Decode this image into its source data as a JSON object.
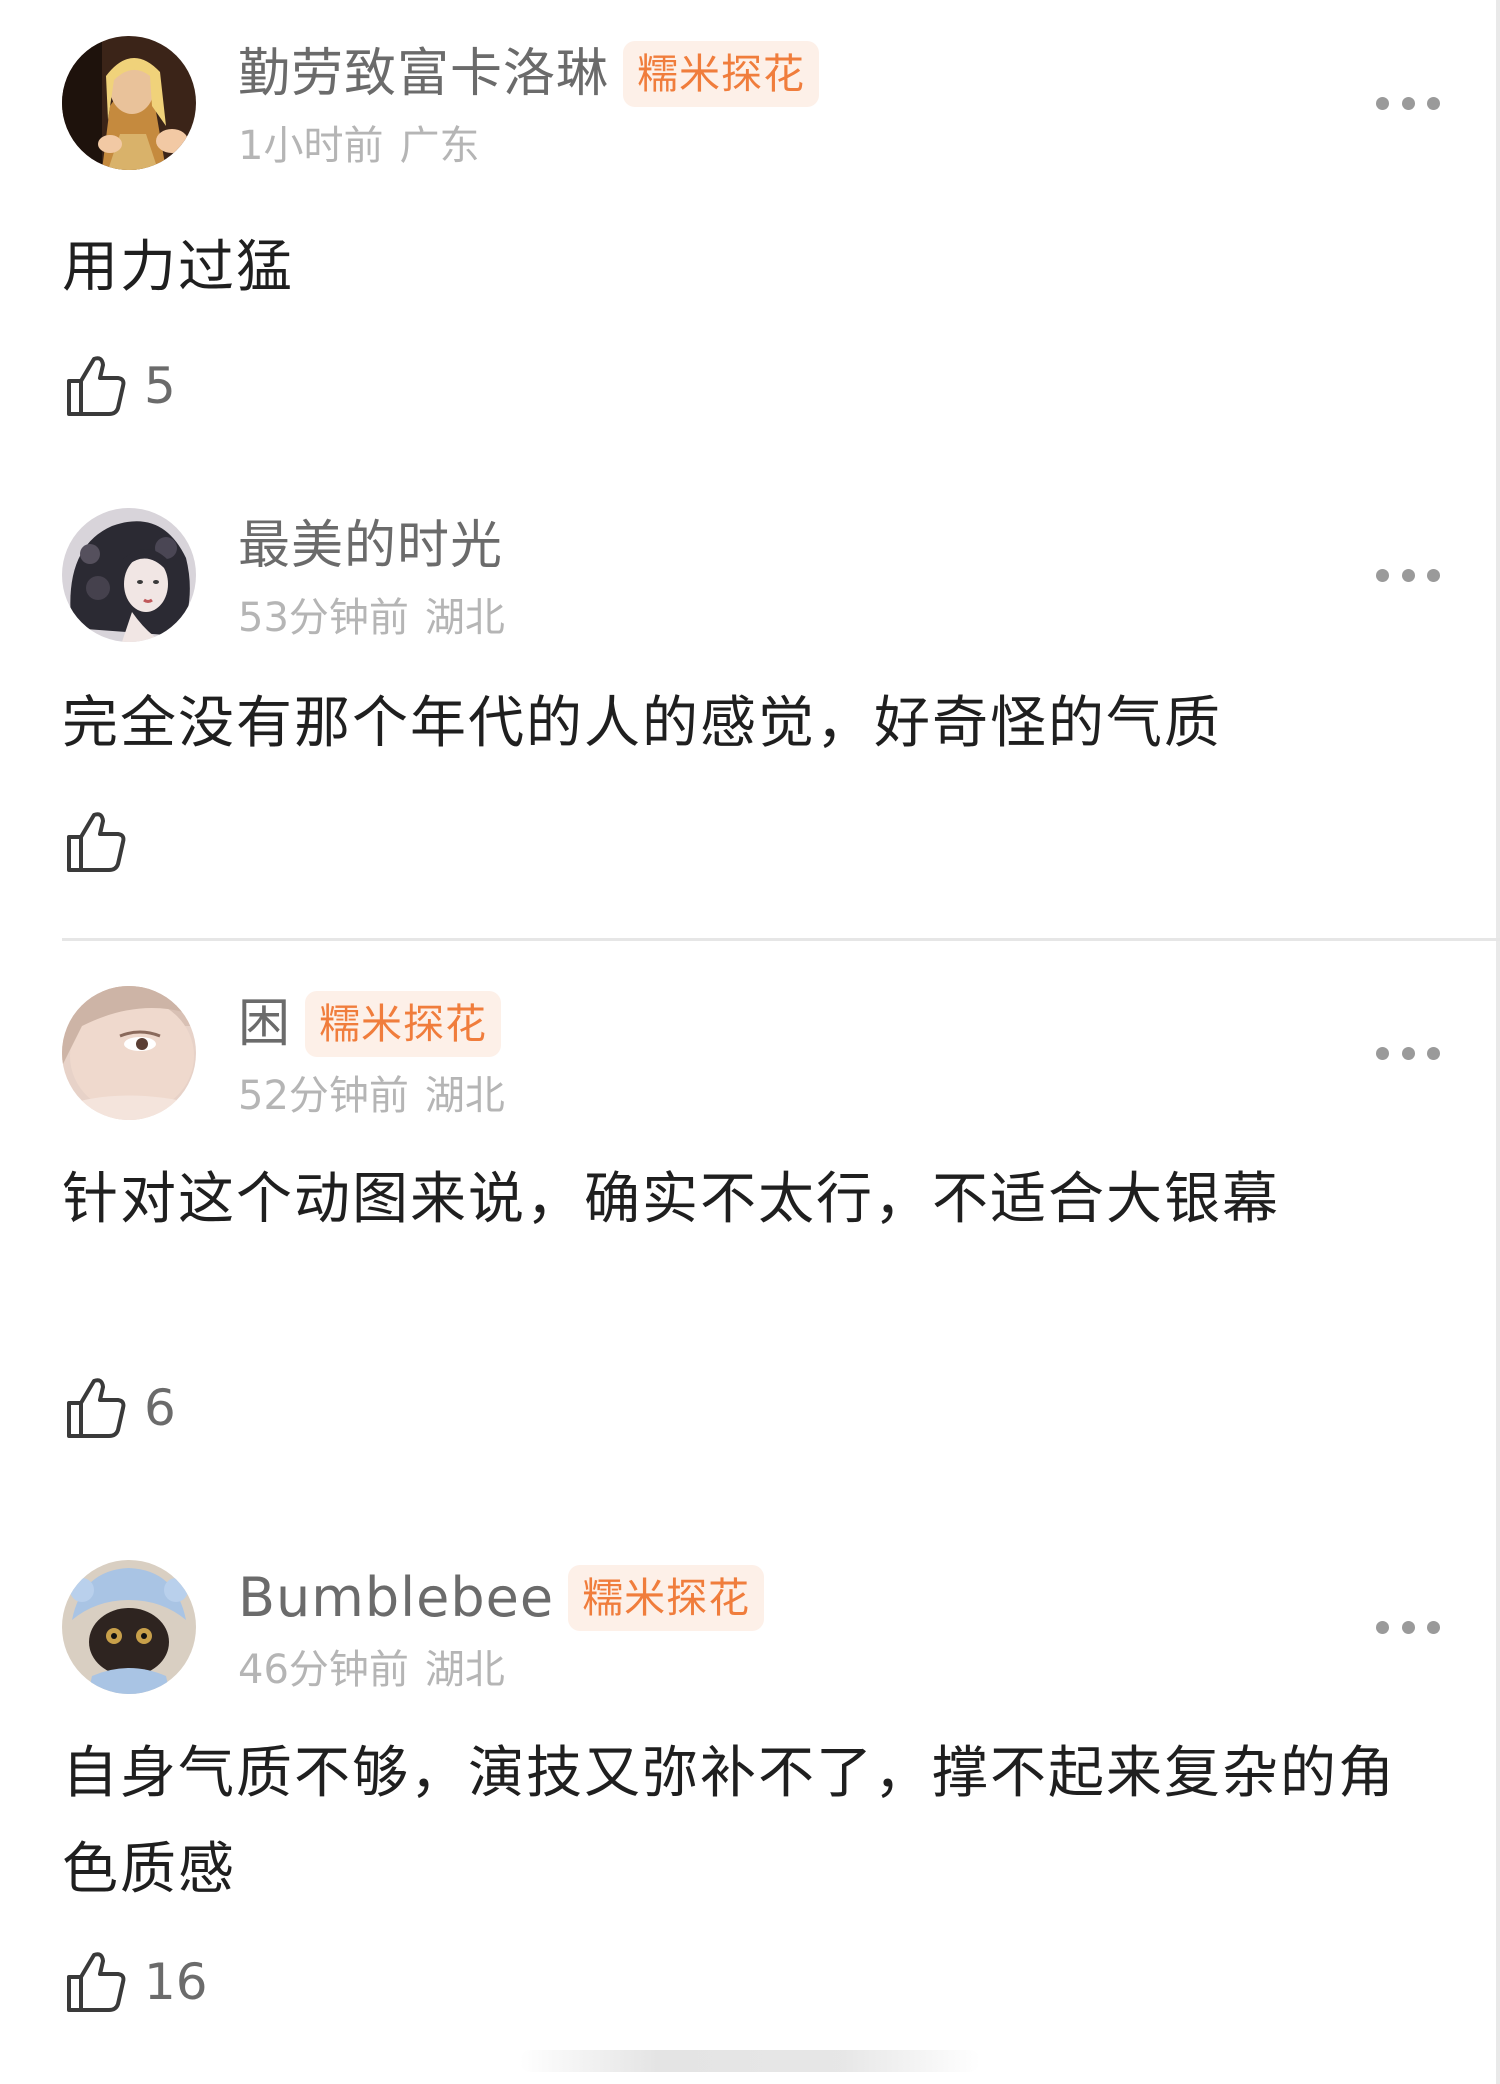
{
  "comments": [
    {
      "username": "勤劳致富卡洛琳",
      "badge": "糯米探花",
      "time": "1小时前",
      "location": "广东",
      "text": "用力过猛",
      "likes": "5",
      "avatar_icon": "avatar-photo-blonde-woman"
    },
    {
      "username": "最美的时光",
      "badge": "",
      "time": "53分钟前",
      "location": "湖北",
      "text": "完全没有那个年代的人的感觉，好奇怪的气质",
      "likes": "",
      "avatar_icon": "avatar-illustration-dark-haired-woman"
    },
    {
      "username": "困",
      "badge": "糯米探花",
      "time": "52分钟前",
      "location": "湖北",
      "text": "针对这个动图来说，确实不太行，不适合大银幕",
      "likes": "6",
      "avatar_icon": "avatar-photo-woman-closeup"
    },
    {
      "username": "Bumblebee",
      "badge": "糯米探花",
      "time": "46分钟前",
      "location": "湖北",
      "text": "自身气质不够，演技又弥补不了，撑不起来复杂的角色质感",
      "likes": "16",
      "avatar_icon": "avatar-photo-cat-in-blue-hat"
    }
  ],
  "colors": {
    "badge_bg": "#fdf0e8",
    "badge_text": "#f07d3c",
    "username": "#6b6b6b",
    "meta": "#b5b5b5",
    "body_text": "#1f1f1f"
  },
  "icons": {
    "more": "more-dots-icon",
    "like": "thumbs-up-icon"
  }
}
